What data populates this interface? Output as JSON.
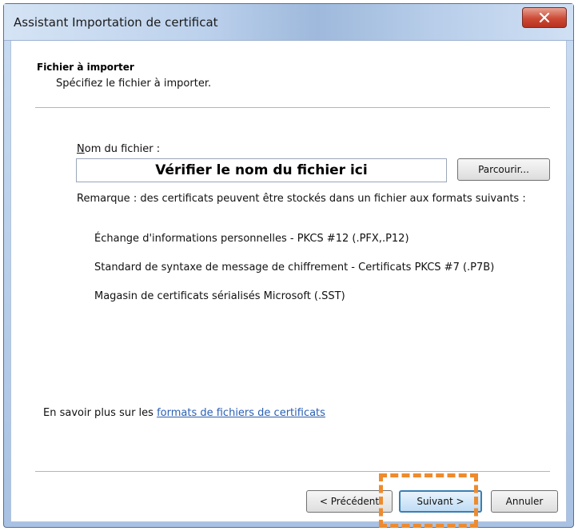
{
  "window": {
    "title": "Assistant Importation de certificat"
  },
  "header": {
    "heading": "Fichier à importer",
    "subtitle": "Spécifiez le fichier à importer."
  },
  "file": {
    "label_mnemonic": "N",
    "label_rest": "om du fichier :",
    "value": "Vérifier le nom du fichier ici",
    "browse_label": "Parcourir..."
  },
  "remark": "Remarque : des certificats peuvent être stockés dans un fichier aux formats suivants :",
  "formats": [
    "Échange d'informations personnelles - PKCS #12 (.PFX,.P12)",
    "Standard de syntaxe de message de chiffrement - Certificats PKCS #7 (.P7B)",
    "Magasin de certificats sérialisés Microsoft (.SST)"
  ],
  "more_info": {
    "prefix": "En savoir plus sur les ",
    "link": "formats de fichiers de certificats"
  },
  "buttons": {
    "prev": "< Précédent",
    "next": "Suivant >",
    "cancel": "Annuler"
  },
  "colors": {
    "highlight": "#ee8b2e",
    "link": "#2a5fb4",
    "close": "#cc4a36"
  }
}
